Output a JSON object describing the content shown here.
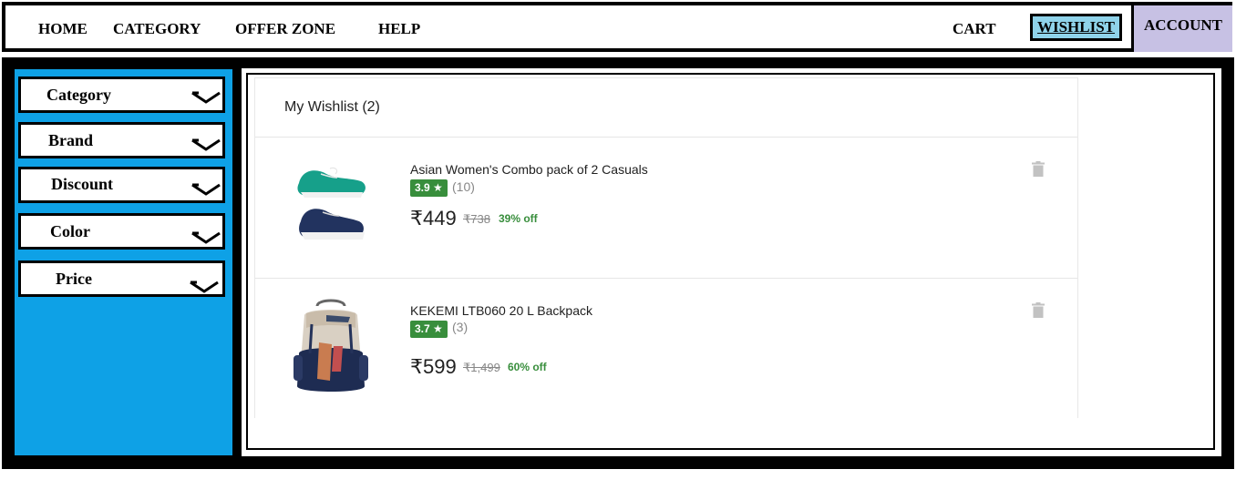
{
  "nav": {
    "home": "HOME",
    "category": "CATEGORY",
    "offer_zone": "OFFER ZONE",
    "help": "HELP",
    "cart": "CART",
    "wishlist": "WISHLIST",
    "account": "ACCOUNT"
  },
  "colors": {
    "sidebar": "#0ea1e6",
    "wishlist_active": "#8fd3ea",
    "account_bg": "#c7c1e4",
    "rating_green": "#388e3c"
  },
  "filters": [
    {
      "label": "Category",
      "icon": "chevron-down-icon"
    },
    {
      "label": "Brand",
      "icon": "chevron-down-icon"
    },
    {
      "label": "Discount",
      "icon": "chevron-down-icon"
    },
    {
      "label": "Color",
      "icon": "chevron-down-icon"
    },
    {
      "label": "Price",
      "icon": "chevron-down-icon"
    }
  ],
  "wishlist": {
    "title": "My Wishlist (2)",
    "items": [
      {
        "name": "Asian Women's Combo pack of 2 Casuals",
        "rating": "3.9 ★",
        "reviews": "(10)",
        "price": "₹449",
        "mrp": "₹738",
        "off": "39% off",
        "image": "shoes-image"
      },
      {
        "name": "KEKEMI LTB060 20 L Backpack",
        "rating": "3.7 ★",
        "reviews": "(3)",
        "price": "₹599",
        "mrp": "₹1,499",
        "off": "60% off",
        "image": "backpack-image"
      }
    ]
  }
}
